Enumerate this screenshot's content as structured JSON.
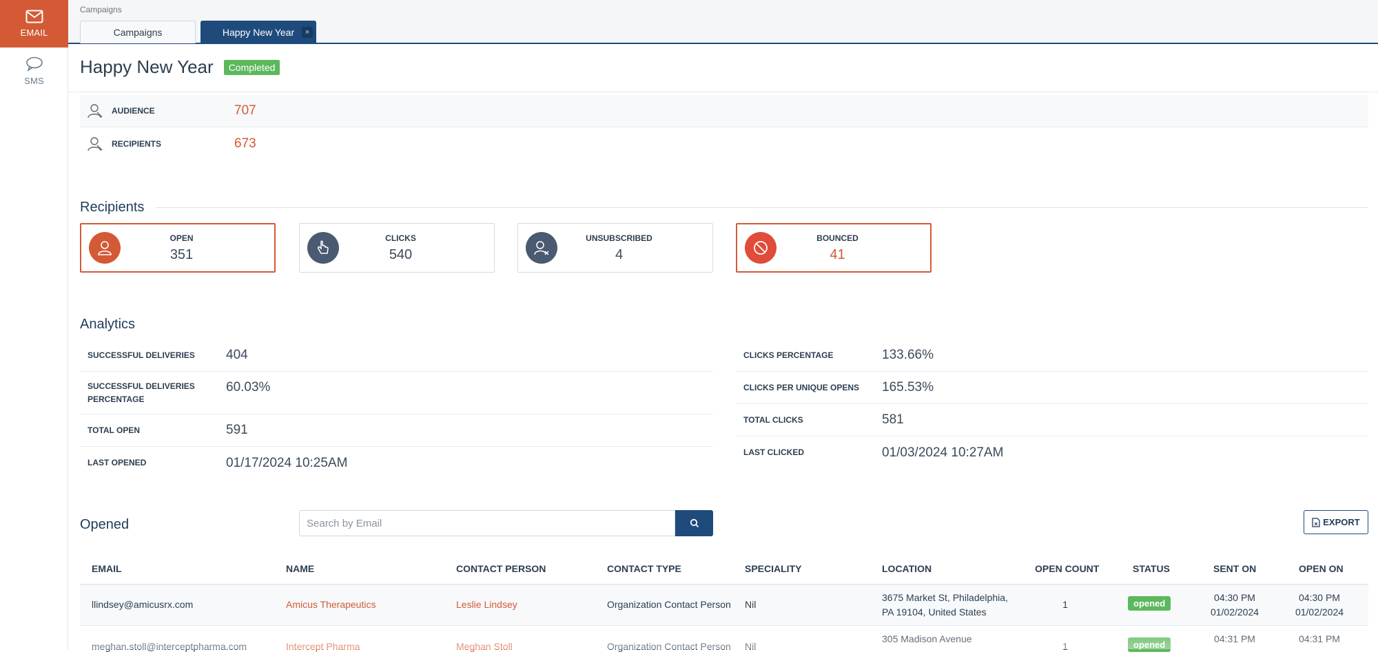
{
  "sidebar": {
    "email_label": "EMAIL",
    "sms_label": "SMS"
  },
  "breadcrumb": "Campaigns",
  "tabs": [
    {
      "label": "Campaigns"
    },
    {
      "label": "Happy New Year",
      "close": "×"
    }
  ],
  "campaign": {
    "title": "Happy New Year",
    "status": "Completed",
    "audience_label": "AUDIENCE",
    "audience_value": "707",
    "recipients_label": "RECIPIENTS",
    "recipients_value": "673"
  },
  "recipients_section": {
    "title": "Recipients",
    "cards": [
      {
        "label": "OPEN",
        "value": "351"
      },
      {
        "label": "CLICKS",
        "value": "540"
      },
      {
        "label": "UNSUBSCRIBED",
        "value": "4"
      },
      {
        "label": "BOUNCED",
        "value": "41"
      }
    ]
  },
  "analytics": {
    "title": "Analytics",
    "left": [
      {
        "label": "SUCCESSFUL DELIVERIES",
        "value": "404"
      },
      {
        "label_line1": "SUCCESSFUL DELIVERIES",
        "label_line2": "PERCENTAGE",
        "value": "60.03%"
      },
      {
        "label": "TOTAL OPEN",
        "value": "591"
      },
      {
        "label": "LAST OPENED",
        "value": "01/17/2024 10:25AM"
      }
    ],
    "right": [
      {
        "label": "CLICKS PERCENTAGE",
        "value": "133.66%"
      },
      {
        "label": "CLICKS PER UNIQUE OPENS",
        "value": "165.53%"
      },
      {
        "label": "TOTAL CLICKS",
        "value": "581"
      },
      {
        "label": "LAST CLICKED",
        "value": "01/03/2024 10:27AM"
      }
    ]
  },
  "opened": {
    "title": "Opened",
    "search_placeholder": "Search by Email",
    "search_value": "",
    "export_label": "EXPORT",
    "columns": [
      "EMAIL",
      "NAME",
      "CONTACT PERSON",
      "CONTACT TYPE",
      "SPECIALITY",
      "LOCATION",
      "OPEN COUNT",
      "STATUS",
      "SENT ON",
      "OPEN ON"
    ],
    "rows": [
      {
        "email": "llindsey@amicusrx.com",
        "name": "Amicus Therapeutics",
        "contact_person": "Leslie Lindsey",
        "contact_type": "Organization Contact Person",
        "speciality": "Nil",
        "location_line1": "3675 Market St, Philadelphia,",
        "location_line2": "PA 19104, United States",
        "open_count": "1",
        "status": "opened",
        "sent_time": "04:30 PM",
        "sent_date": "01/02/2024",
        "open_time": "04:30 PM",
        "open_date": "01/02/2024"
      },
      {
        "email": "meghan.stoll@interceptpharma.com",
        "name": "Intercept Pharma",
        "contact_person": "Meghan Stoll",
        "contact_type": "Organization Contact Person",
        "speciality": "Nil",
        "location_line1": "305 Madison Avenue",
        "open_count": "1",
        "status": "opened",
        "sent_time": "04:31 PM",
        "open_time": "04:31 PM"
      }
    ]
  },
  "colors": {
    "accent": "#d35a35",
    "primary": "#1f4a7c",
    "success": "#5cb85c"
  },
  "icons": [
    "envelope-icon",
    "chat-bubble-icon",
    "user-icon",
    "pointer-hand-icon",
    "user-remove-icon",
    "block-icon",
    "search-icon",
    "file-export-icon"
  ]
}
